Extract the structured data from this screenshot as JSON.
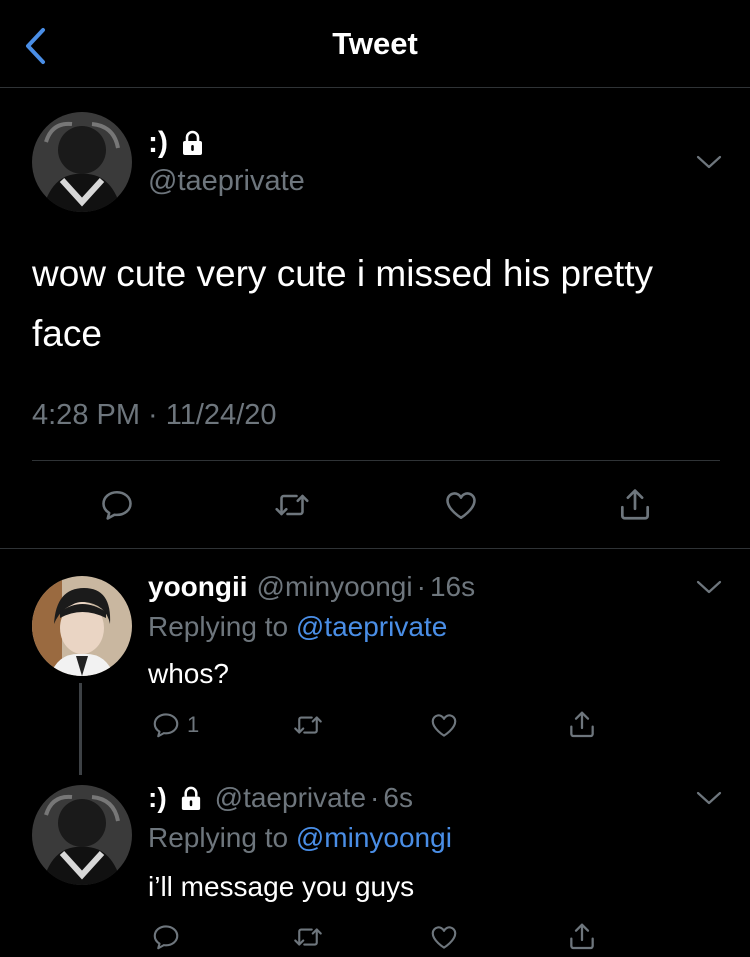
{
  "nav": {
    "title": "Tweet"
  },
  "main_tweet": {
    "display_name": ":)",
    "handle": "@taeprivate",
    "text": "wow cute very cute i missed his pretty face",
    "timestamp": "4:28 PM · 11/24/20"
  },
  "replies": [
    {
      "display_name": "yoongii",
      "handle": "@minyoongi",
      "separator": "·",
      "time": "16s",
      "replying_prefix": "Replying to",
      "replying_to": "@taeprivate",
      "text": "whos?",
      "reply_count": "1"
    },
    {
      "display_name": ":)",
      "handle": "@taeprivate",
      "separator": "·",
      "time": "6s",
      "replying_prefix": "Replying to",
      "replying_to": "@minyoongi",
      "text": "i’ll message you guys"
    }
  ],
  "colors": {
    "background": "#000000",
    "text": "#ffffff",
    "secondary": "#6e767d",
    "accent": "#4a8ee6",
    "divider": "#2f3336"
  },
  "icons": [
    "chevron-left-icon",
    "lock-icon",
    "chevron-down-icon",
    "reply-icon",
    "retweet-icon",
    "like-icon",
    "share-icon"
  ]
}
